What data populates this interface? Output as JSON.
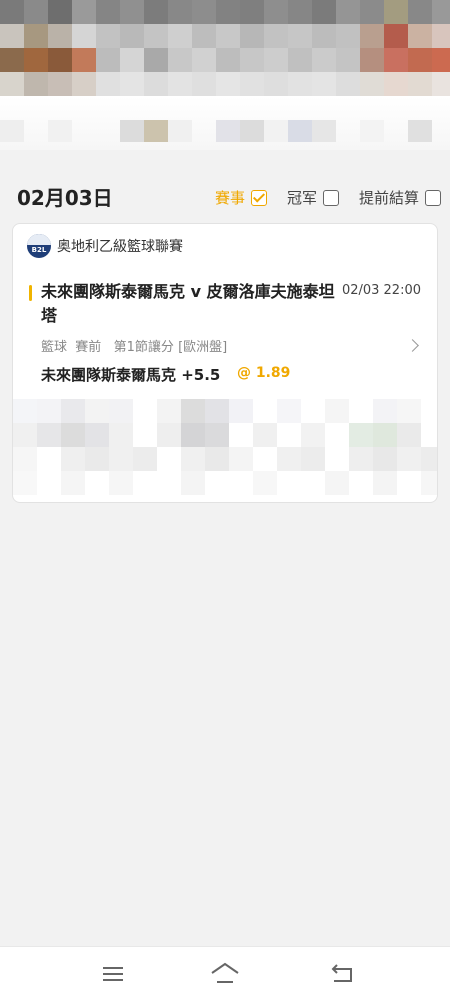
{
  "date_header": {
    "title": "02月03日",
    "filters": [
      {
        "label": "賽事",
        "checked": true
      },
      {
        "label": "冠军",
        "checked": false
      },
      {
        "label": "提前結算",
        "checked": false
      }
    ]
  },
  "bet_card": {
    "league_logo_text": "B2L",
    "league_name": "奥地利乙級籃球聯賽",
    "match_title": "未來團隊斯泰爾馬克 v 皮爾洛庫夫施泰坦塔",
    "match_time": "02/03 22:00",
    "market_info": "籃球  賽前   第1節讓分 [歐洲盤]",
    "selection": "未來團隊斯泰爾馬克 +5.5",
    "odds": "@ 1.89"
  },
  "colors": {
    "accent": "#f0a800",
    "background": "#f2f2f2",
    "card": "#ffffff"
  },
  "navbar": {
    "icons": [
      "menu-icon",
      "home-icon",
      "back-icon"
    ]
  }
}
